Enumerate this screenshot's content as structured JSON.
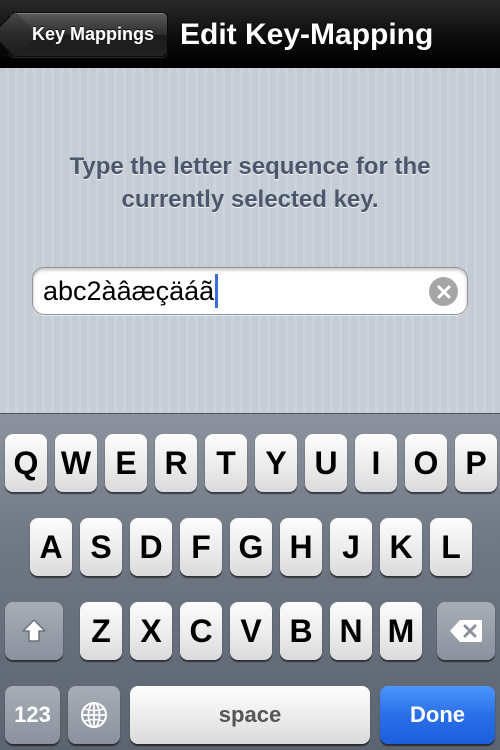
{
  "navbar": {
    "back_label": "Key Mappings",
    "title": "Edit Key-Mapping"
  },
  "content": {
    "instructions": "Type the letter sequence for the currently selected key.",
    "field_value": "abc2àâæçäáã",
    "clear_icon": "clear-circle-icon"
  },
  "keyboard": {
    "row1": [
      "Q",
      "W",
      "E",
      "R",
      "T",
      "Y",
      "U",
      "I",
      "O",
      "P"
    ],
    "row2": [
      "A",
      "S",
      "D",
      "F",
      "G",
      "H",
      "J",
      "K",
      "L"
    ],
    "row3": [
      "Z",
      "X",
      "C",
      "V",
      "B",
      "N",
      "M"
    ],
    "shift_icon": "shift-arrow-icon",
    "backspace_icon": "backspace-icon",
    "globe_icon": "globe-icon",
    "numbers_label": "123",
    "space_label": "space",
    "done_label": "Done"
  },
  "colors": {
    "navbar": "#000000",
    "instructions_text": "#4c566c",
    "done_key": "#2a6fe8",
    "cursor": "#3a6ee0"
  }
}
